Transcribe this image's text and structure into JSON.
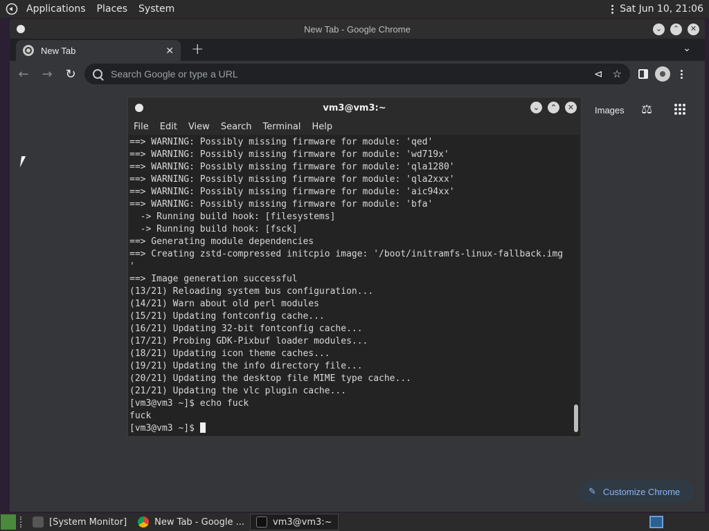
{
  "top_panel": {
    "menus": [
      "Applications",
      "Places",
      "System"
    ],
    "clock": "Sat Jun 10, 21:06"
  },
  "chrome": {
    "window_title": "New Tab - Google Chrome",
    "tab_title": "New Tab",
    "omnibox_placeholder": "Search Google or type a URL",
    "images_link": "Images",
    "customize_label": "Customize Chrome"
  },
  "terminal": {
    "window_title": "vm3@vm3:~",
    "menu": [
      "File",
      "Edit",
      "View",
      "Search",
      "Terminal",
      "Help"
    ],
    "lines": [
      "==> WARNING: Possibly missing firmware for module: 'qed'",
      "==> WARNING: Possibly missing firmware for module: 'wd719x'",
      "==> WARNING: Possibly missing firmware for module: 'qla1280'",
      "==> WARNING: Possibly missing firmware for module: 'qla2xxx'",
      "==> WARNING: Possibly missing firmware for module: 'aic94xx'",
      "==> WARNING: Possibly missing firmware for module: 'bfa'",
      "  -> Running build hook: [filesystems]",
      "  -> Running build hook: [fsck]",
      "==> Generating module dependencies",
      "==> Creating zstd-compressed initcpio image: '/boot/initramfs-linux-fallback.img",
      "'",
      "==> Image generation successful",
      "(13/21) Reloading system bus configuration...",
      "(14/21) Warn about old perl modules",
      "(15/21) Updating fontconfig cache...",
      "(16/21) Updating 32-bit fontconfig cache...",
      "(17/21) Probing GDK-Pixbuf loader modules...",
      "(18/21) Updating icon theme caches...",
      "(19/21) Updating the info directory file...",
      "(20/21) Updating the desktop file MIME type cache...",
      "(21/21) Updating the vlc plugin cache...",
      "[vm3@vm3 ~]$ echo fuck",
      "fuck"
    ],
    "prompt": "[vm3@vm3 ~]$ "
  },
  "taskbar": {
    "tasks": [
      "[System Monitor]",
      "New Tab - Google ...",
      "vm3@vm3:~"
    ]
  },
  "colors": {
    "panel_bg": "#2b2b2b",
    "chrome_bg": "#35363a",
    "accent_blue": "#8ab4f8"
  }
}
